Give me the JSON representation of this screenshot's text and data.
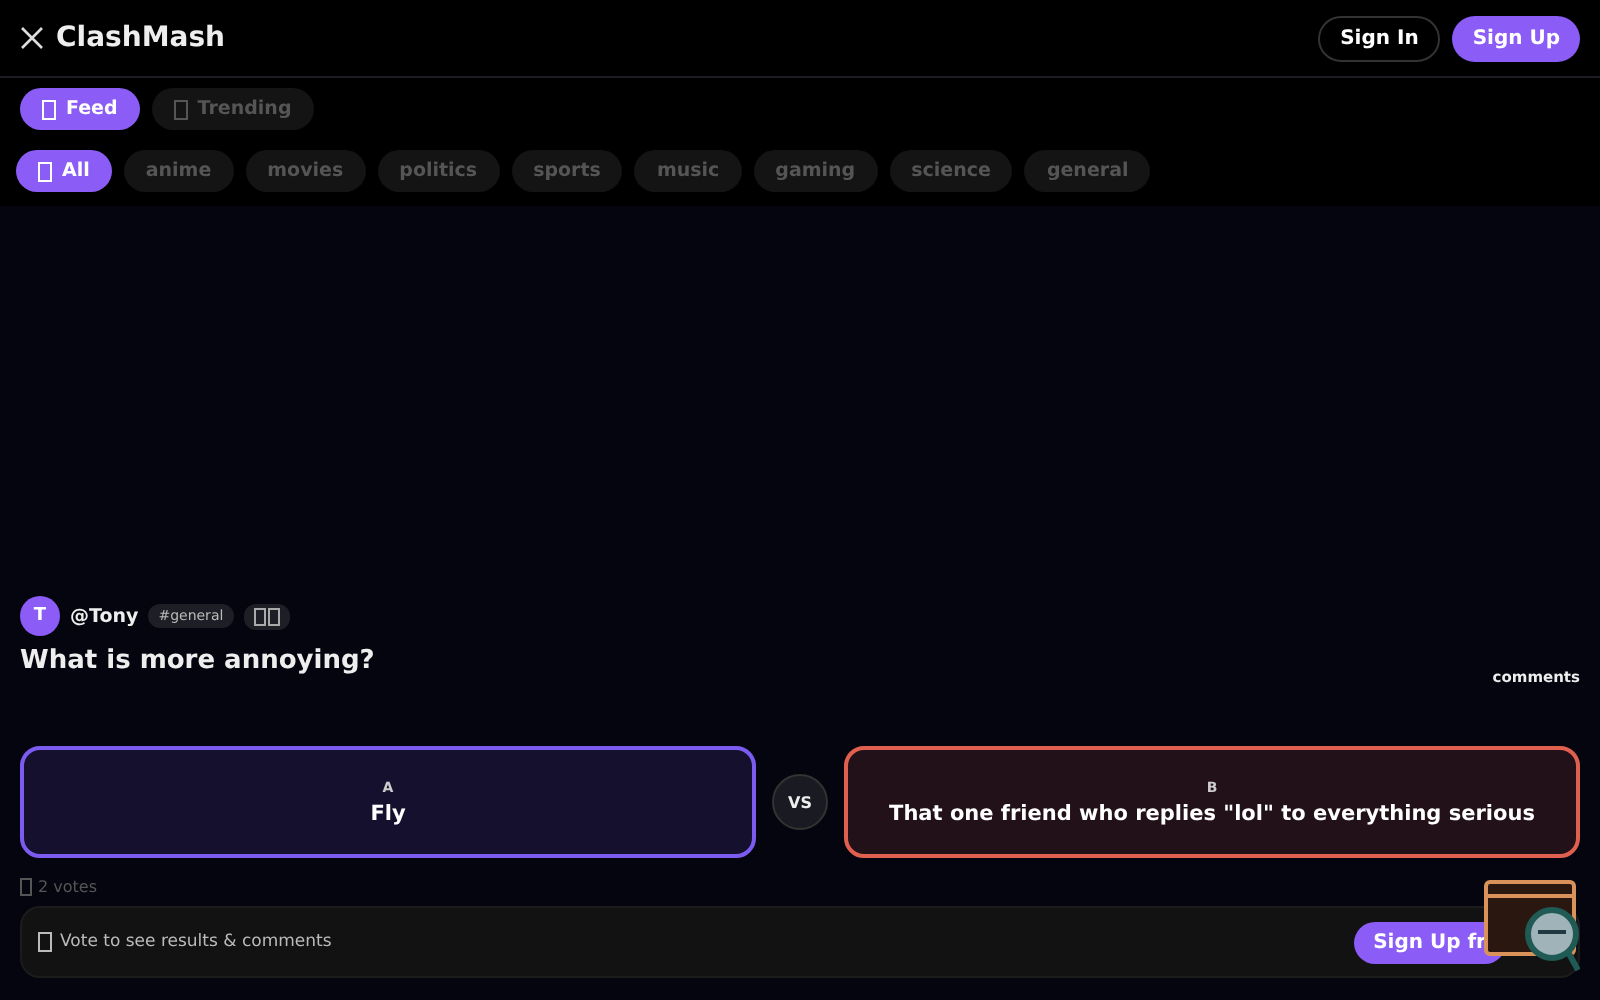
{
  "brand": {
    "name": "ClashMash"
  },
  "auth": {
    "sign_in": "Sign In",
    "sign_up": "Sign Up"
  },
  "view_tabs": [
    {
      "label": "Feed",
      "selected": true
    },
    {
      "label": "Trending",
      "selected": false
    }
  ],
  "categories": [
    {
      "label": "All",
      "selected": true
    },
    {
      "label": "anime",
      "selected": false
    },
    {
      "label": "movies",
      "selected": false
    },
    {
      "label": "politics",
      "selected": false
    },
    {
      "label": "sports",
      "selected": false
    },
    {
      "label": "music",
      "selected": false
    },
    {
      "label": "gaming",
      "selected": false
    },
    {
      "label": "science",
      "selected": false
    },
    {
      "label": "general",
      "selected": false
    }
  ],
  "post": {
    "avatar": "T",
    "author": "@Tony",
    "tag": "#general",
    "question": "What is more annoying?",
    "comments_label": "comments",
    "options": [
      {
        "letter": "A",
        "text": "Fly",
        "color": "#7c5cf0"
      },
      {
        "letter": "B",
        "text": "That one friend who replies \"lol\" to everything serious",
        "color": "#e0604f"
      }
    ],
    "vs": "VS",
    "votes": "2 votes",
    "cta_text": "Vote to see results & comments",
    "cta_button": "Sign Up fr"
  }
}
